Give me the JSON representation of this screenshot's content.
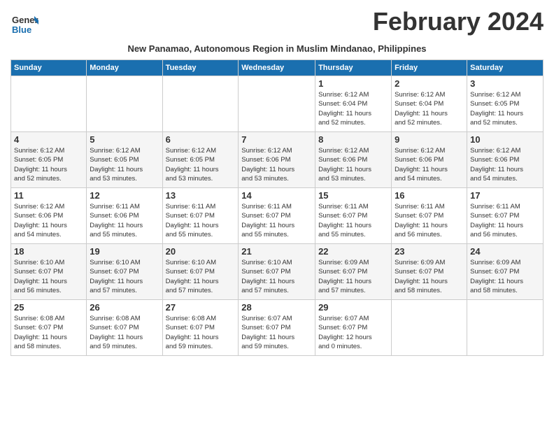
{
  "logo": {
    "line1": "General",
    "line2": "Blue"
  },
  "title": "February 2024",
  "subtitle": "New Panamao, Autonomous Region in Muslim Mindanao, Philippines",
  "days_of_week": [
    "Sunday",
    "Monday",
    "Tuesday",
    "Wednesday",
    "Thursday",
    "Friday",
    "Saturday"
  ],
  "weeks": [
    [
      {
        "day": "",
        "info": ""
      },
      {
        "day": "",
        "info": ""
      },
      {
        "day": "",
        "info": ""
      },
      {
        "day": "",
        "info": ""
      },
      {
        "day": "1",
        "info": "Sunrise: 6:12 AM\nSunset: 6:04 PM\nDaylight: 11 hours\nand 52 minutes."
      },
      {
        "day": "2",
        "info": "Sunrise: 6:12 AM\nSunset: 6:04 PM\nDaylight: 11 hours\nand 52 minutes."
      },
      {
        "day": "3",
        "info": "Sunrise: 6:12 AM\nSunset: 6:05 PM\nDaylight: 11 hours\nand 52 minutes."
      }
    ],
    [
      {
        "day": "4",
        "info": "Sunrise: 6:12 AM\nSunset: 6:05 PM\nDaylight: 11 hours\nand 52 minutes."
      },
      {
        "day": "5",
        "info": "Sunrise: 6:12 AM\nSunset: 6:05 PM\nDaylight: 11 hours\nand 53 minutes."
      },
      {
        "day": "6",
        "info": "Sunrise: 6:12 AM\nSunset: 6:05 PM\nDaylight: 11 hours\nand 53 minutes."
      },
      {
        "day": "7",
        "info": "Sunrise: 6:12 AM\nSunset: 6:06 PM\nDaylight: 11 hours\nand 53 minutes."
      },
      {
        "day": "8",
        "info": "Sunrise: 6:12 AM\nSunset: 6:06 PM\nDaylight: 11 hours\nand 53 minutes."
      },
      {
        "day": "9",
        "info": "Sunrise: 6:12 AM\nSunset: 6:06 PM\nDaylight: 11 hours\nand 54 minutes."
      },
      {
        "day": "10",
        "info": "Sunrise: 6:12 AM\nSunset: 6:06 PM\nDaylight: 11 hours\nand 54 minutes."
      }
    ],
    [
      {
        "day": "11",
        "info": "Sunrise: 6:12 AM\nSunset: 6:06 PM\nDaylight: 11 hours\nand 54 minutes."
      },
      {
        "day": "12",
        "info": "Sunrise: 6:11 AM\nSunset: 6:06 PM\nDaylight: 11 hours\nand 55 minutes."
      },
      {
        "day": "13",
        "info": "Sunrise: 6:11 AM\nSunset: 6:07 PM\nDaylight: 11 hours\nand 55 minutes."
      },
      {
        "day": "14",
        "info": "Sunrise: 6:11 AM\nSunset: 6:07 PM\nDaylight: 11 hours\nand 55 minutes."
      },
      {
        "day": "15",
        "info": "Sunrise: 6:11 AM\nSunset: 6:07 PM\nDaylight: 11 hours\nand 55 minutes."
      },
      {
        "day": "16",
        "info": "Sunrise: 6:11 AM\nSunset: 6:07 PM\nDaylight: 11 hours\nand 56 minutes."
      },
      {
        "day": "17",
        "info": "Sunrise: 6:11 AM\nSunset: 6:07 PM\nDaylight: 11 hours\nand 56 minutes."
      }
    ],
    [
      {
        "day": "18",
        "info": "Sunrise: 6:10 AM\nSunset: 6:07 PM\nDaylight: 11 hours\nand 56 minutes."
      },
      {
        "day": "19",
        "info": "Sunrise: 6:10 AM\nSunset: 6:07 PM\nDaylight: 11 hours\nand 57 minutes."
      },
      {
        "day": "20",
        "info": "Sunrise: 6:10 AM\nSunset: 6:07 PM\nDaylight: 11 hours\nand 57 minutes."
      },
      {
        "day": "21",
        "info": "Sunrise: 6:10 AM\nSunset: 6:07 PM\nDaylight: 11 hours\nand 57 minutes."
      },
      {
        "day": "22",
        "info": "Sunrise: 6:09 AM\nSunset: 6:07 PM\nDaylight: 11 hours\nand 57 minutes."
      },
      {
        "day": "23",
        "info": "Sunrise: 6:09 AM\nSunset: 6:07 PM\nDaylight: 11 hours\nand 58 minutes."
      },
      {
        "day": "24",
        "info": "Sunrise: 6:09 AM\nSunset: 6:07 PM\nDaylight: 11 hours\nand 58 minutes."
      }
    ],
    [
      {
        "day": "25",
        "info": "Sunrise: 6:08 AM\nSunset: 6:07 PM\nDaylight: 11 hours\nand 58 minutes."
      },
      {
        "day": "26",
        "info": "Sunrise: 6:08 AM\nSunset: 6:07 PM\nDaylight: 11 hours\nand 59 minutes."
      },
      {
        "day": "27",
        "info": "Sunrise: 6:08 AM\nSunset: 6:07 PM\nDaylight: 11 hours\nand 59 minutes."
      },
      {
        "day": "28",
        "info": "Sunrise: 6:07 AM\nSunset: 6:07 PM\nDaylight: 11 hours\nand 59 minutes."
      },
      {
        "day": "29",
        "info": "Sunrise: 6:07 AM\nSunset: 6:07 PM\nDaylight: 12 hours\nand 0 minutes."
      },
      {
        "day": "",
        "info": ""
      },
      {
        "day": "",
        "info": ""
      }
    ]
  ]
}
